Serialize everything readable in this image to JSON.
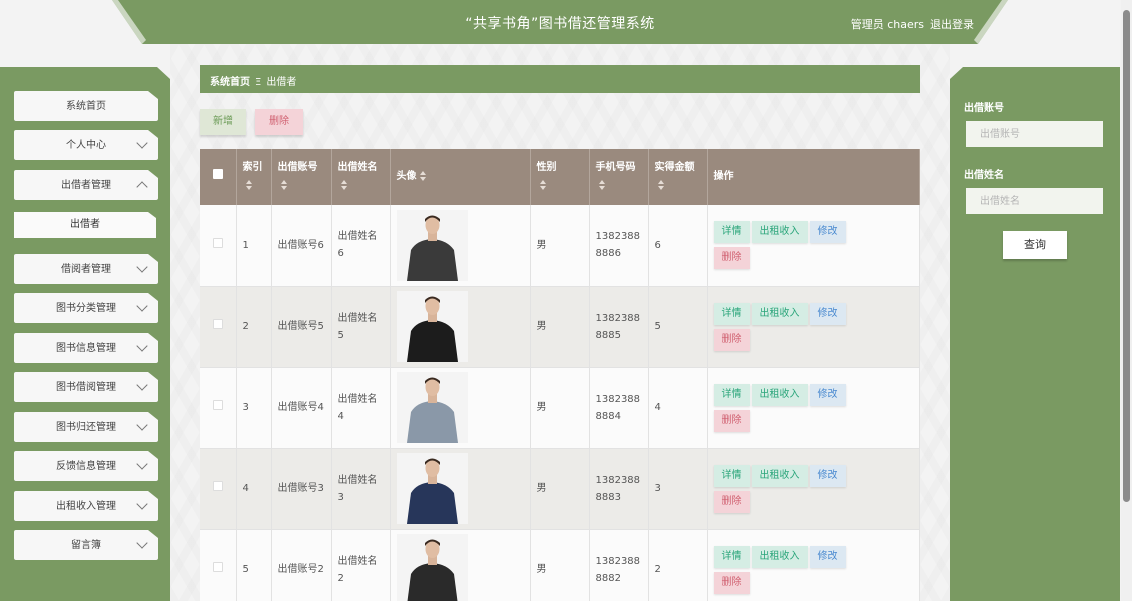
{
  "header": {
    "title": "“共享书角”图书借还管理系统",
    "user": "管理员 chaers",
    "logout": "退出登录"
  },
  "sidebar": {
    "items": [
      {
        "label": "系统首页",
        "chevron": "none"
      },
      {
        "label": "个人中心",
        "chevron": "down"
      },
      {
        "label": "出借者管理",
        "chevron": "up"
      },
      {
        "label": "借阅者管理",
        "chevron": "down"
      },
      {
        "label": "图书分类管理",
        "chevron": "down"
      },
      {
        "label": "图书信息管理",
        "chevron": "down"
      },
      {
        "label": "图书借阅管理",
        "chevron": "down"
      },
      {
        "label": "图书归还管理",
        "chevron": "down"
      },
      {
        "label": "反馈信息管理",
        "chevron": "down"
      },
      {
        "label": "出租收入管理",
        "chevron": "down"
      },
      {
        "label": "留言簿",
        "chevron": "down"
      }
    ],
    "sub_item": "出借者"
  },
  "breadcrumb": {
    "home": "系统首页",
    "separator": "Ξ",
    "current": "出借者"
  },
  "toolbar": {
    "add": "新增",
    "delete": "删除"
  },
  "table": {
    "headers": {
      "index": "索引",
      "account": "出借账号",
      "name": "出借姓名",
      "avatar": "头像",
      "gender": "性别",
      "phone": "手机号码",
      "amount": "实得金额",
      "ops": "操作"
    },
    "ops": {
      "detail": "详情",
      "income": "出租收入",
      "edit": "修改",
      "delete": "删除"
    },
    "rows": [
      {
        "index": "1",
        "account": "出借账号6",
        "name": "出借姓名6",
        "gender": "男",
        "phone": "13823888886",
        "amount": "6",
        "shirt": "#3a3a3a"
      },
      {
        "index": "2",
        "account": "出借账号5",
        "name": "出借姓名5",
        "gender": "男",
        "phone": "13823888885",
        "amount": "5",
        "shirt": "#1c1c1c"
      },
      {
        "index": "3",
        "account": "出借账号4",
        "name": "出借姓名4",
        "gender": "男",
        "phone": "13823888884",
        "amount": "4",
        "shirt": "#8a98a8"
      },
      {
        "index": "4",
        "account": "出借账号3",
        "name": "出借姓名3",
        "gender": "男",
        "phone": "13823888883",
        "amount": "3",
        "shirt": "#27365a"
      },
      {
        "index": "5",
        "account": "出借账号2",
        "name": "出借姓名2",
        "gender": "男",
        "phone": "13823888882",
        "amount": "2",
        "shirt": "#2a2a2a"
      }
    ]
  },
  "search": {
    "account_label": "出借账号",
    "account_placeholder": "出借账号",
    "name_label": "出借姓名",
    "name_placeholder": "出借姓名",
    "button": "查询"
  },
  "colors": {
    "accent": "#7a9a62",
    "table_header": "#9a8a7e"
  }
}
